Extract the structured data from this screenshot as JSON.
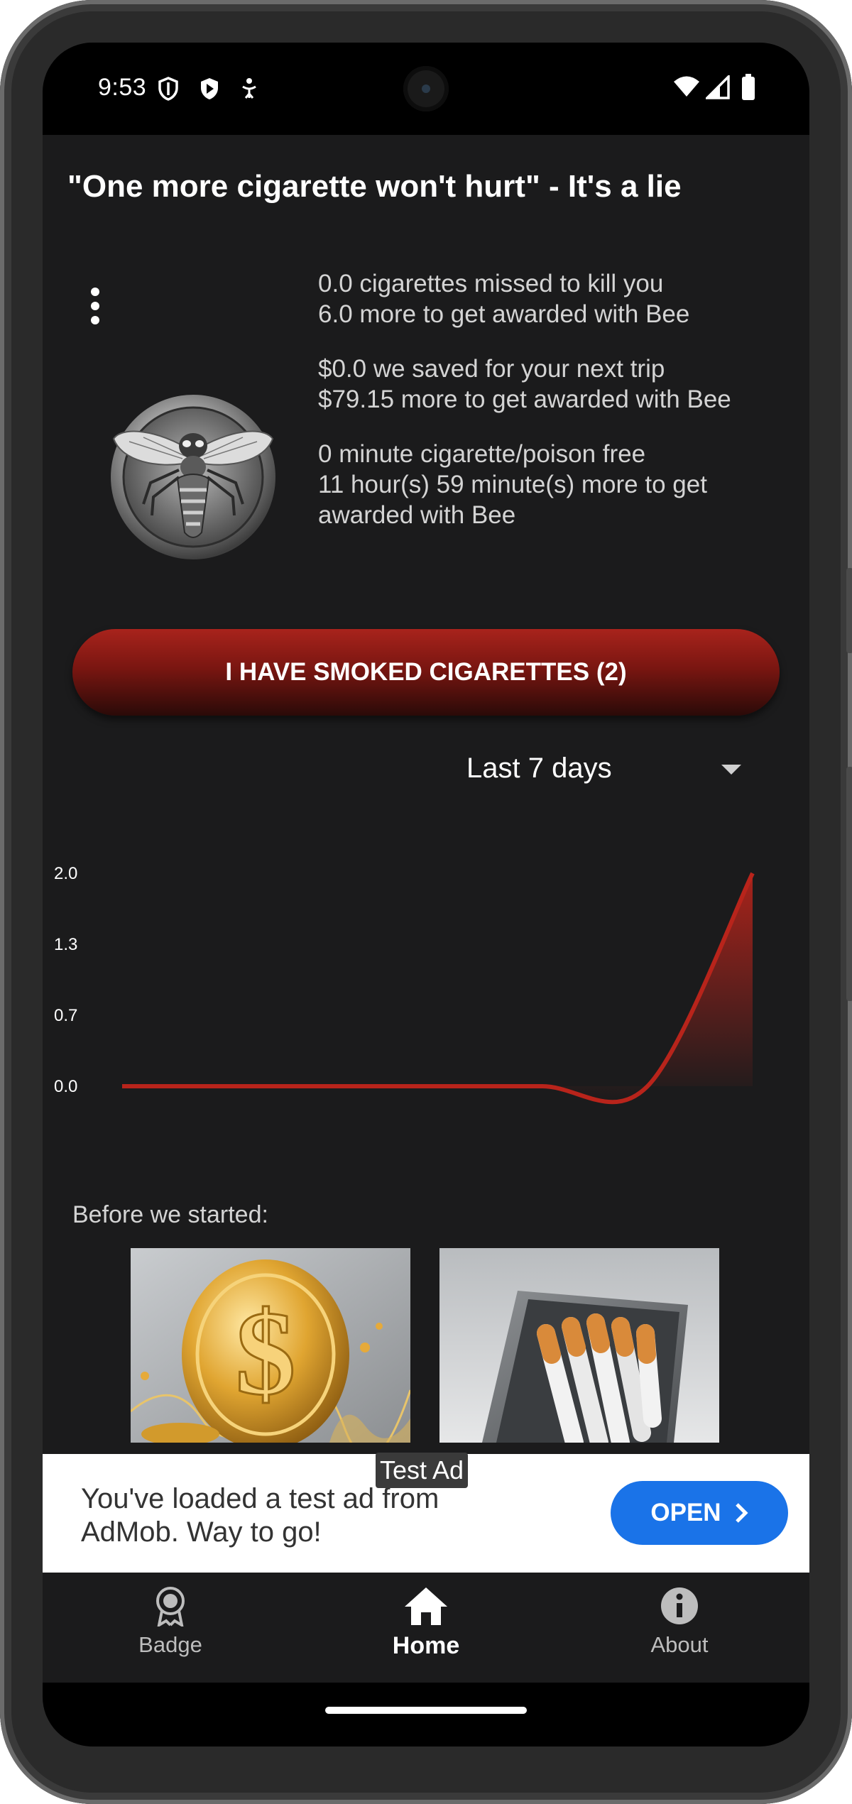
{
  "status_bar": {
    "time": "9:53"
  },
  "header": {
    "title": "\"One more cigarette won't hurt\" - It's a lie"
  },
  "stats": {
    "cigarettes_line1": "0.0 cigarettes missed to kill you",
    "cigarettes_line2": "6.0 more to get awarded with Bee",
    "money_line1": "$0.0 we saved for your next trip",
    "money_line2": "$79.15 more to get awarded with Bee",
    "time_line1": "0 minute cigarette/poison free",
    "time_line2": "11 hour(s) 59 minute(s) more to get awarded with Bee"
  },
  "badge": {
    "icon": "bee-coin"
  },
  "smoked_button": {
    "label": "I HAVE SMOKED CIGARETTES (2)"
  },
  "period_select": {
    "selected": "Last 7 days"
  },
  "chart_data": {
    "type": "area",
    "x": [
      1,
      2,
      3,
      4,
      5,
      6,
      7
    ],
    "values": [
      0,
      0,
      0,
      0,
      0,
      0,
      2
    ],
    "y_ticks": [
      "2.0",
      "1.3",
      "0.7",
      "0.0"
    ],
    "ylim": [
      0,
      2
    ],
    "grid": false,
    "line_color": "#b8241b"
  },
  "before_section": {
    "label": "Before we started:",
    "images": [
      "gold-dollar-coin",
      "cigarette-tin"
    ]
  },
  "ad": {
    "label": "Test Ad",
    "text": "You've loaded a test ad from AdMob. Way to go!",
    "button": "OPEN",
    "button_color": "#1a73e8"
  },
  "nav": {
    "items": [
      {
        "label": "Badge",
        "icon": "award-icon"
      },
      {
        "label": "Home",
        "icon": "home-icon"
      },
      {
        "label": "About",
        "icon": "info-icon"
      }
    ]
  }
}
